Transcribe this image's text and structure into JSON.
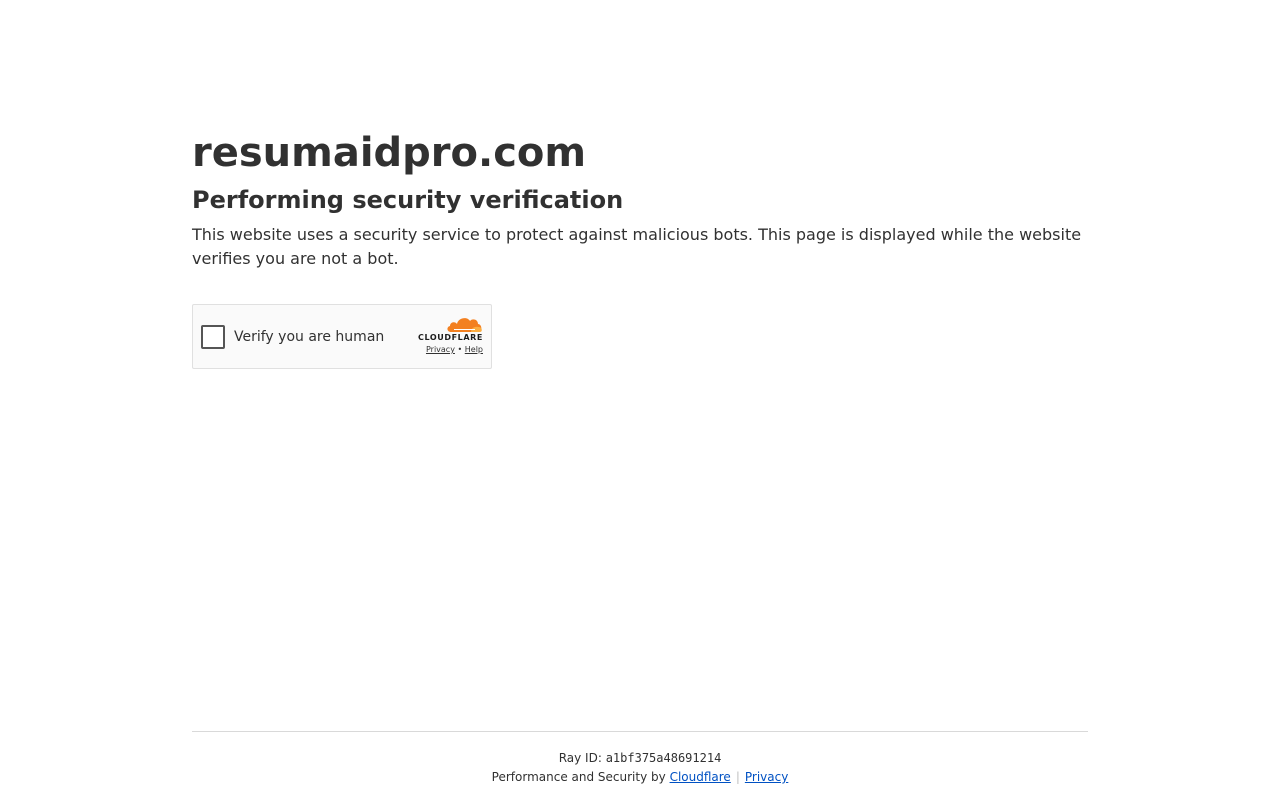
{
  "site": {
    "domain": "resumaidpro.com"
  },
  "challenge": {
    "heading": "Performing security verification",
    "description": "This website uses a security service to protect against malicious bots. This page is displayed while the website verifies you are not a bot."
  },
  "widget": {
    "checkbox_label": "Verify you are human",
    "brand": "CLOUDFLARE",
    "privacy_link": "Privacy",
    "link_separator": "•",
    "help_link": "Help",
    "brand_color": "#f38020"
  },
  "footer": {
    "ray_label": "Ray ID:",
    "ray_id": "a1bf375a48691214",
    "perf_text": "Performance and Security by",
    "cloudflare_link": "Cloudflare",
    "separator": "|",
    "privacy_link": "Privacy",
    "link_color": "#0051c3"
  }
}
